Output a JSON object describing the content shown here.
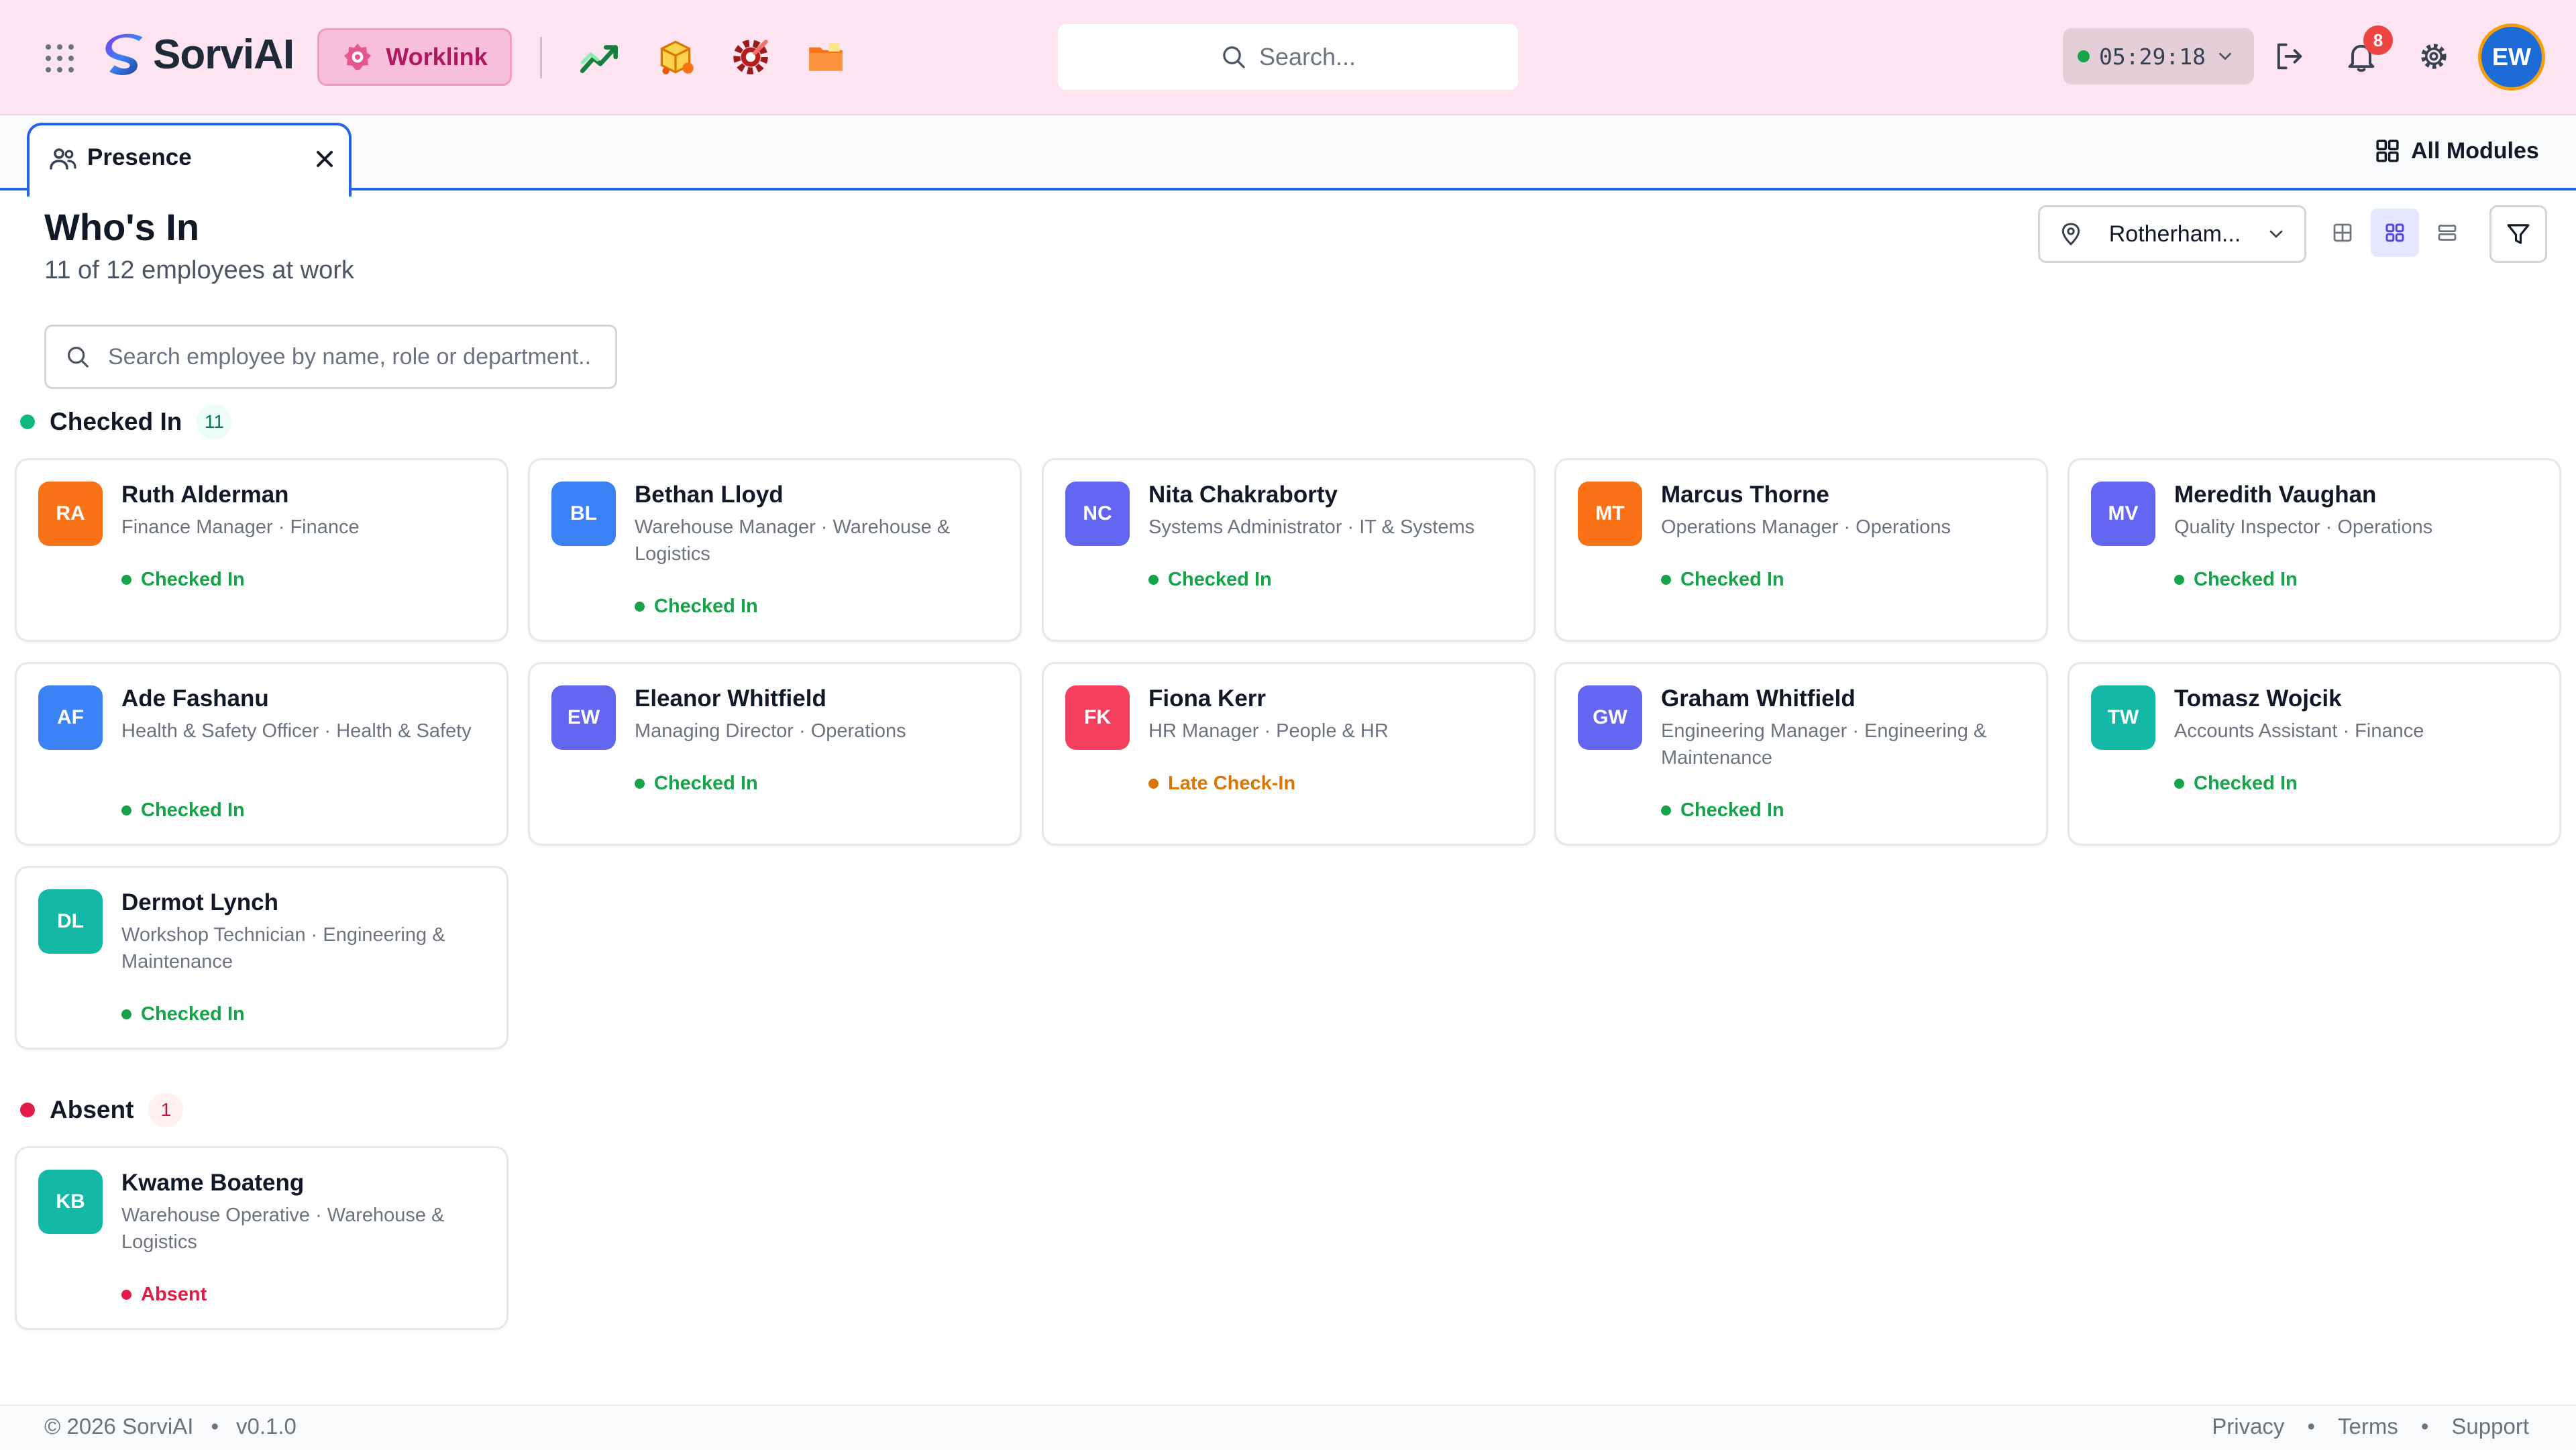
{
  "app": {
    "name": "SorviAI",
    "active_module": "Worklink",
    "global_search_placeholder": "Search...",
    "timer": "05:29:18",
    "notifications_count": "8",
    "user_initials": "EW"
  },
  "tabs": {
    "active_label": "Presence",
    "all_modules_label": "All Modules"
  },
  "page": {
    "title": "Who's In",
    "subtitle": "11 of 12 employees at work",
    "location": "Rotherham...",
    "search_placeholder": "Search employee by name, role or department..",
    "view_mode": "cards"
  },
  "sections": {
    "checked_in": {
      "title": "Checked In",
      "count": "11",
      "color": "#10b981"
    },
    "absent": {
      "title": "Absent",
      "count": "1",
      "color": "#e11d48"
    }
  },
  "checked_in_employees": [
    {
      "initials": "RA",
      "name": "Ruth Alderman",
      "role": "Finance Manager · Finance",
      "status": "Checked In",
      "color": "#f97316",
      "status_color": "#16a34a"
    },
    {
      "initials": "BL",
      "name": "Bethan Lloyd",
      "role": "Warehouse Manager · Warehouse & Logistics",
      "status": "Checked In",
      "color": "#3b82f6",
      "status_color": "#16a34a"
    },
    {
      "initials": "NC",
      "name": "Nita Chakraborty",
      "role": "Systems Administrator · IT & Systems",
      "status": "Checked In",
      "color": "#6366f1",
      "status_color": "#16a34a"
    },
    {
      "initials": "MT",
      "name": "Marcus Thorne",
      "role": "Operations Manager · Operations",
      "status": "Checked In",
      "color": "#f97316",
      "status_color": "#16a34a"
    },
    {
      "initials": "MV",
      "name": "Meredith Vaughan",
      "role": "Quality Inspector · Operations",
      "status": "Checked In",
      "color": "#6366f1",
      "status_color": "#16a34a"
    },
    {
      "initials": "AF",
      "name": "Ade Fashanu",
      "role": "Health & Safety Officer · Health & Safety",
      "status": "Checked In",
      "color": "#3b82f6",
      "status_color": "#16a34a"
    },
    {
      "initials": "EW",
      "name": "Eleanor Whitfield",
      "role": "Managing Director · Operations",
      "status": "Checked In",
      "color": "#6366f1",
      "status_color": "#16a34a"
    },
    {
      "initials": "FK",
      "name": "Fiona Kerr",
      "role": "HR Manager · People & HR",
      "status": "Late Check-In",
      "color": "#f43f5e",
      "status_color": "#d97706"
    },
    {
      "initials": "GW",
      "name": "Graham Whitfield",
      "role": "Engineering Manager · Engineering & Maintenance",
      "status": "Checked In",
      "color": "#6366f1",
      "status_color": "#16a34a"
    },
    {
      "initials": "TW",
      "name": "Tomasz Wojcik",
      "role": "Accounts Assistant · Finance",
      "status": "Checked In",
      "color": "#14b8a6",
      "status_color": "#16a34a"
    },
    {
      "initials": "DL",
      "name": "Dermot Lynch",
      "role": "Workshop Technician · Engineering & Maintenance",
      "status": "Checked In",
      "color": "#14b8a6",
      "status_color": "#16a34a"
    }
  ],
  "absent_employees": [
    {
      "initials": "KB",
      "name": "Kwame Boateng",
      "role": "Warehouse Operative · Warehouse & Logistics",
      "status": "Absent",
      "color": "#14b8a6",
      "status_color": "#e11d48"
    }
  ],
  "footer": {
    "copyright": "© 2026 SorviAI",
    "version": "v0.1.0",
    "links": [
      "Privacy",
      "Terms",
      "Support"
    ]
  },
  "icons": {
    "apps": "grid-dots-icon",
    "module_1": "trending-up-icon",
    "module_2": "package-icon",
    "module_3": "gear-wrench-icon",
    "module_4": "folder-icon",
    "timer_status": "online-dot",
    "logout": "logout-icon",
    "notifications": "bell-icon",
    "settings": "gear-icon"
  }
}
